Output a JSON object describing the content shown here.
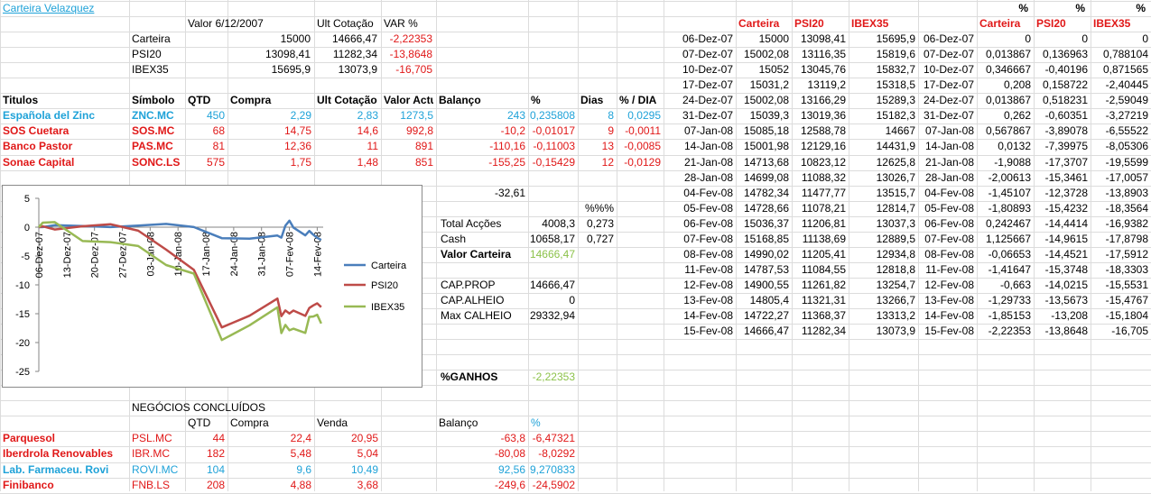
{
  "top": {
    "title": "Carteira Velazquez",
    "headers": [
      "Valor 6/12/2007",
      "Ult Cotação",
      "VAR %"
    ],
    "rows": [
      {
        "label": "Carteira",
        "valor": "15000",
        "ult": "14666,47",
        "var": "-2,22353"
      },
      {
        "label": "PSI20",
        "valor": "13098,41",
        "ult": "11282,34",
        "var": "-13,8648"
      },
      {
        "label": "IBEX35",
        "valor": "15695,9",
        "ult": "13073,9",
        "var": "-16,705"
      }
    ]
  },
  "holdings": {
    "headers": [
      "Titulos",
      "Símbolo",
      "QTD",
      "Compra",
      "Ult Cotação",
      "Valor Actual",
      "Balanço",
      "%",
      "Dias",
      "% / DIA"
    ],
    "rows": [
      {
        "name": "Española del Zinc",
        "symbol": "ZNC.MC",
        "qtd": "450",
        "compra": "2,29",
        "ult": "2,83",
        "valor": "1273,5",
        "balanco": "243",
        "pct": "0,235808",
        "dias": "8",
        "pctdia": "0,0295",
        "color": "blue"
      },
      {
        "name": "SOS Cuetara",
        "symbol": "SOS.MC",
        "qtd": "68",
        "compra": "14,75",
        "ult": "14,6",
        "valor": "992,8",
        "balanco": "-10,2",
        "pct": "-0,01017",
        "dias": "9",
        "pctdia": "-0,0011",
        "color": "red"
      },
      {
        "name": "Banco Pastor",
        "symbol": "PAS.MC",
        "qtd": "81",
        "compra": "12,36",
        "ult": "11",
        "valor": "891",
        "balanco": "-110,16",
        "pct": "-0,11003",
        "dias": "13",
        "pctdia": "-0,0085",
        "color": "red"
      },
      {
        "name": "Sonae Capital",
        "symbol": "SONC.LS",
        "qtd": "575",
        "compra": "1,75",
        "ult": "1,48",
        "valor": "851",
        "balanco": "-155,25",
        "pct": "-0,15429",
        "dias": "12",
        "pctdia": "-0,0129",
        "color": "red"
      }
    ]
  },
  "summary": {
    "balanco_total": "-32,61",
    "pct_header": "%%%",
    "total_accoes_label": "Total Acções",
    "total_accoes": "4008,3",
    "total_accoes_pct": "0,273",
    "cash_label": "Cash",
    "cash": "10658,17",
    "cash_pct": "0,727",
    "valor_carteira_label": "Valor Carteira",
    "valor_carteira": "14666,47",
    "cap_prop_label": "CAP.PROP",
    "cap_prop": "14666,47",
    "cap_alheio_label": "CAP.ALHEIO",
    "cap_alheio": "0",
    "max_calheio_label": "Max CALHEIO",
    "max_calheio": "29332,94",
    "ganhos_label": "%GANHOS",
    "ganhos": "-2,22353"
  },
  "closed": {
    "title": "NEGÓCIOS CONCLUÍDOS",
    "headers": [
      "QTD",
      "Compra",
      "Venda",
      "Balanço",
      "%"
    ],
    "rows": [
      {
        "name": "Parquesol",
        "symbol": "PSL.MC",
        "qtd": "44",
        "compra": "22,4",
        "venda": "20,95",
        "balanco": "-63,8",
        "pct": "-6,47321",
        "color": "red"
      },
      {
        "name": "Iberdrola Renovables",
        "symbol": "IBR.MC",
        "qtd": "182",
        "compra": "5,48",
        "venda": "5,04",
        "balanco": "-80,08",
        "pct": "-8,0292",
        "color": "red"
      },
      {
        "name": "Lab. Farmaceu. Rovi",
        "symbol": "ROVI.MC",
        "qtd": "104",
        "compra": "9,6",
        "venda": "10,49",
        "balanco": "92,56",
        "pct": "9,270833",
        "color": "blue"
      },
      {
        "name": "Finibanco",
        "symbol": "FNB.LS",
        "qtd": "208",
        "compra": "4,88",
        "venda": "3,68",
        "balanco": "-249,6",
        "pct": "-24,5902",
        "color": "red"
      }
    ]
  },
  "history": {
    "headers": [
      "Carteira",
      "PSI20",
      "IBEX35"
    ],
    "pct_headers": [
      "%",
      "%",
      "%"
    ],
    "rows": [
      [
        "06-Dez-07",
        "15000",
        "13098,41",
        "15695,9",
        "0",
        "0",
        "0"
      ],
      [
        "07-Dez-07",
        "15002,08",
        "13116,35",
        "15819,6",
        "0,013867",
        "0,136963",
        "0,788104"
      ],
      [
        "10-Dez-07",
        "15052",
        "13045,76",
        "15832,7",
        "0,346667",
        "-0,40196",
        "0,871565"
      ],
      [
        "17-Dez-07",
        "15031,2",
        "13119,2",
        "15318,5",
        "0,208",
        "0,158722",
        "-2,40445"
      ],
      [
        "24-Dez-07",
        "15002,08",
        "13166,29",
        "15289,3",
        "0,013867",
        "0,518231",
        "-2,59049"
      ],
      [
        "31-Dez-07",
        "15039,3",
        "13019,36",
        "15182,3",
        "0,262",
        "-0,60351",
        "-3,27219"
      ],
      [
        "07-Jan-08",
        "15085,18",
        "12588,78",
        "14667",
        "0,567867",
        "-3,89078",
        "-6,55522"
      ],
      [
        "14-Jan-08",
        "15001,98",
        "12129,16",
        "14431,9",
        "0,0132",
        "-7,39975",
        "-8,05306"
      ],
      [
        "21-Jan-08",
        "14713,68",
        "10823,12",
        "12625,8",
        "-1,9088",
        "-17,3707",
        "-19,5599"
      ],
      [
        "28-Jan-08",
        "14699,08",
        "11088,32",
        "13026,7",
        "-2,00613",
        "-15,3461",
        "-17,0057"
      ],
      [
        "04-Fev-08",
        "14782,34",
        "11477,77",
        "13515,7",
        "-1,45107",
        "-12,3728",
        "-13,8903"
      ],
      [
        "05-Fev-08",
        "14728,66",
        "11078,21",
        "12814,7",
        "-1,80893",
        "-15,4232",
        "-18,3564"
      ],
      [
        "06-Fev-08",
        "15036,37",
        "11206,81",
        "13037,3",
        "0,242467",
        "-14,4414",
        "-16,9382"
      ],
      [
        "07-Fev-08",
        "15168,85",
        "11138,69",
        "12889,5",
        "1,125667",
        "-14,9615",
        "-17,8798"
      ],
      [
        "08-Fev-08",
        "14990,02",
        "11205,41",
        "12934,8",
        "-0,06653",
        "-14,4521",
        "-17,5912"
      ],
      [
        "11-Fev-08",
        "14787,53",
        "11084,55",
        "12818,8",
        "-1,41647",
        "-15,3748",
        "-18,3303"
      ],
      [
        "12-Fev-08",
        "14900,55",
        "11261,82",
        "13254,7",
        "-0,663",
        "-14,0215",
        "-15,5531"
      ],
      [
        "13-Fev-08",
        "14805,4",
        "11321,31",
        "13266,7",
        "-1,29733",
        "-13,5673",
        "-15,4767"
      ],
      [
        "14-Fev-08",
        "14722,27",
        "11368,37",
        "13313,2",
        "-1,85153",
        "-13,208",
        "-15,1804"
      ],
      [
        "15-Fev-08",
        "14666,47",
        "11282,34",
        "13073,9",
        "-2,22353",
        "-13,8648",
        "-16,705"
      ]
    ]
  },
  "colors": {
    "red": "#e01818",
    "blue": "#1fa2d8",
    "green": "#8cc24a",
    "carteira_line": "#4a7ebb",
    "psi20_line": "#be4b48",
    "ibex35_line": "#98b954"
  },
  "chart_data": {
    "type": "line",
    "x": [
      "06-Dez-07",
      "07-Dez-07",
      "10-Dez-07",
      "17-Dez-07",
      "24-Dez-07",
      "31-Dez-07",
      "07-Jan-08",
      "14-Jan-08",
      "21-Jan-08",
      "28-Jan-08",
      "04-Fev-08",
      "05-Fev-08",
      "06-Fev-08",
      "07-Fev-08",
      "08-Fev-08",
      "11-Fev-08",
      "12-Fev-08",
      "13-Fev-08",
      "14-Fev-08",
      "15-Fev-08"
    ],
    "tick_labels": [
      "06-Dez-07",
      "13-Dez-07",
      "20-Dez-07",
      "27-Dez-07",
      "03-Jan-08",
      "10-Jan-08",
      "17-Jan-08",
      "24-Jan-08",
      "31-Jan-08",
      "07-Fev-08",
      "14-Fev-08"
    ],
    "tick_dates": [
      "2007-12-06",
      "2007-12-13",
      "2007-12-20",
      "2007-12-27",
      "2008-01-03",
      "2008-01-10",
      "2008-01-17",
      "2008-01-24",
      "2008-01-31",
      "2008-02-07",
      "2008-02-14"
    ],
    "x_dates": [
      "2007-12-06",
      "2007-12-07",
      "2007-12-10",
      "2007-12-17",
      "2007-12-24",
      "2007-12-31",
      "2008-01-07",
      "2008-01-14",
      "2008-01-21",
      "2008-01-28",
      "2008-02-04",
      "2008-02-05",
      "2008-02-06",
      "2008-02-07",
      "2008-02-08",
      "2008-02-11",
      "2008-02-12",
      "2008-02-13",
      "2008-02-14",
      "2008-02-15"
    ],
    "series": [
      {
        "name": "Carteira",
        "values": [
          0,
          0.013867,
          0.346667,
          0.208,
          0.013867,
          0.262,
          0.567867,
          0.0132,
          -1.9088,
          -2.00613,
          -1.45107,
          -1.80893,
          0.242467,
          1.125667,
          -0.06653,
          -1.41647,
          -0.663,
          -1.29733,
          -1.85153,
          -2.22353
        ]
      },
      {
        "name": "PSI20",
        "values": [
          0,
          0.136963,
          -0.40196,
          0.158722,
          0.518231,
          -0.60351,
          -3.89078,
          -7.39975,
          -17.3707,
          -15.3461,
          -12.3728,
          -15.4232,
          -14.4414,
          -14.9615,
          -14.4521,
          -15.3748,
          -14.0215,
          -13.5673,
          -13.208,
          -13.8648
        ]
      },
      {
        "name": "IBEX35",
        "values": [
          0,
          0.788104,
          0.871565,
          -2.40445,
          -2.59049,
          -3.27219,
          -6.55522,
          -8.05306,
          -19.5599,
          -17.0057,
          -13.8903,
          -18.3564,
          -16.9382,
          -17.8798,
          -17.5912,
          -18.3303,
          -15.5531,
          -15.4767,
          -15.1804,
          -16.705
        ]
      }
    ],
    "ylim": [
      -25,
      5
    ],
    "yticks": [
      5,
      0,
      -5,
      -10,
      -15,
      -20,
      -25
    ],
    "legend": "right",
    "grid": false
  }
}
